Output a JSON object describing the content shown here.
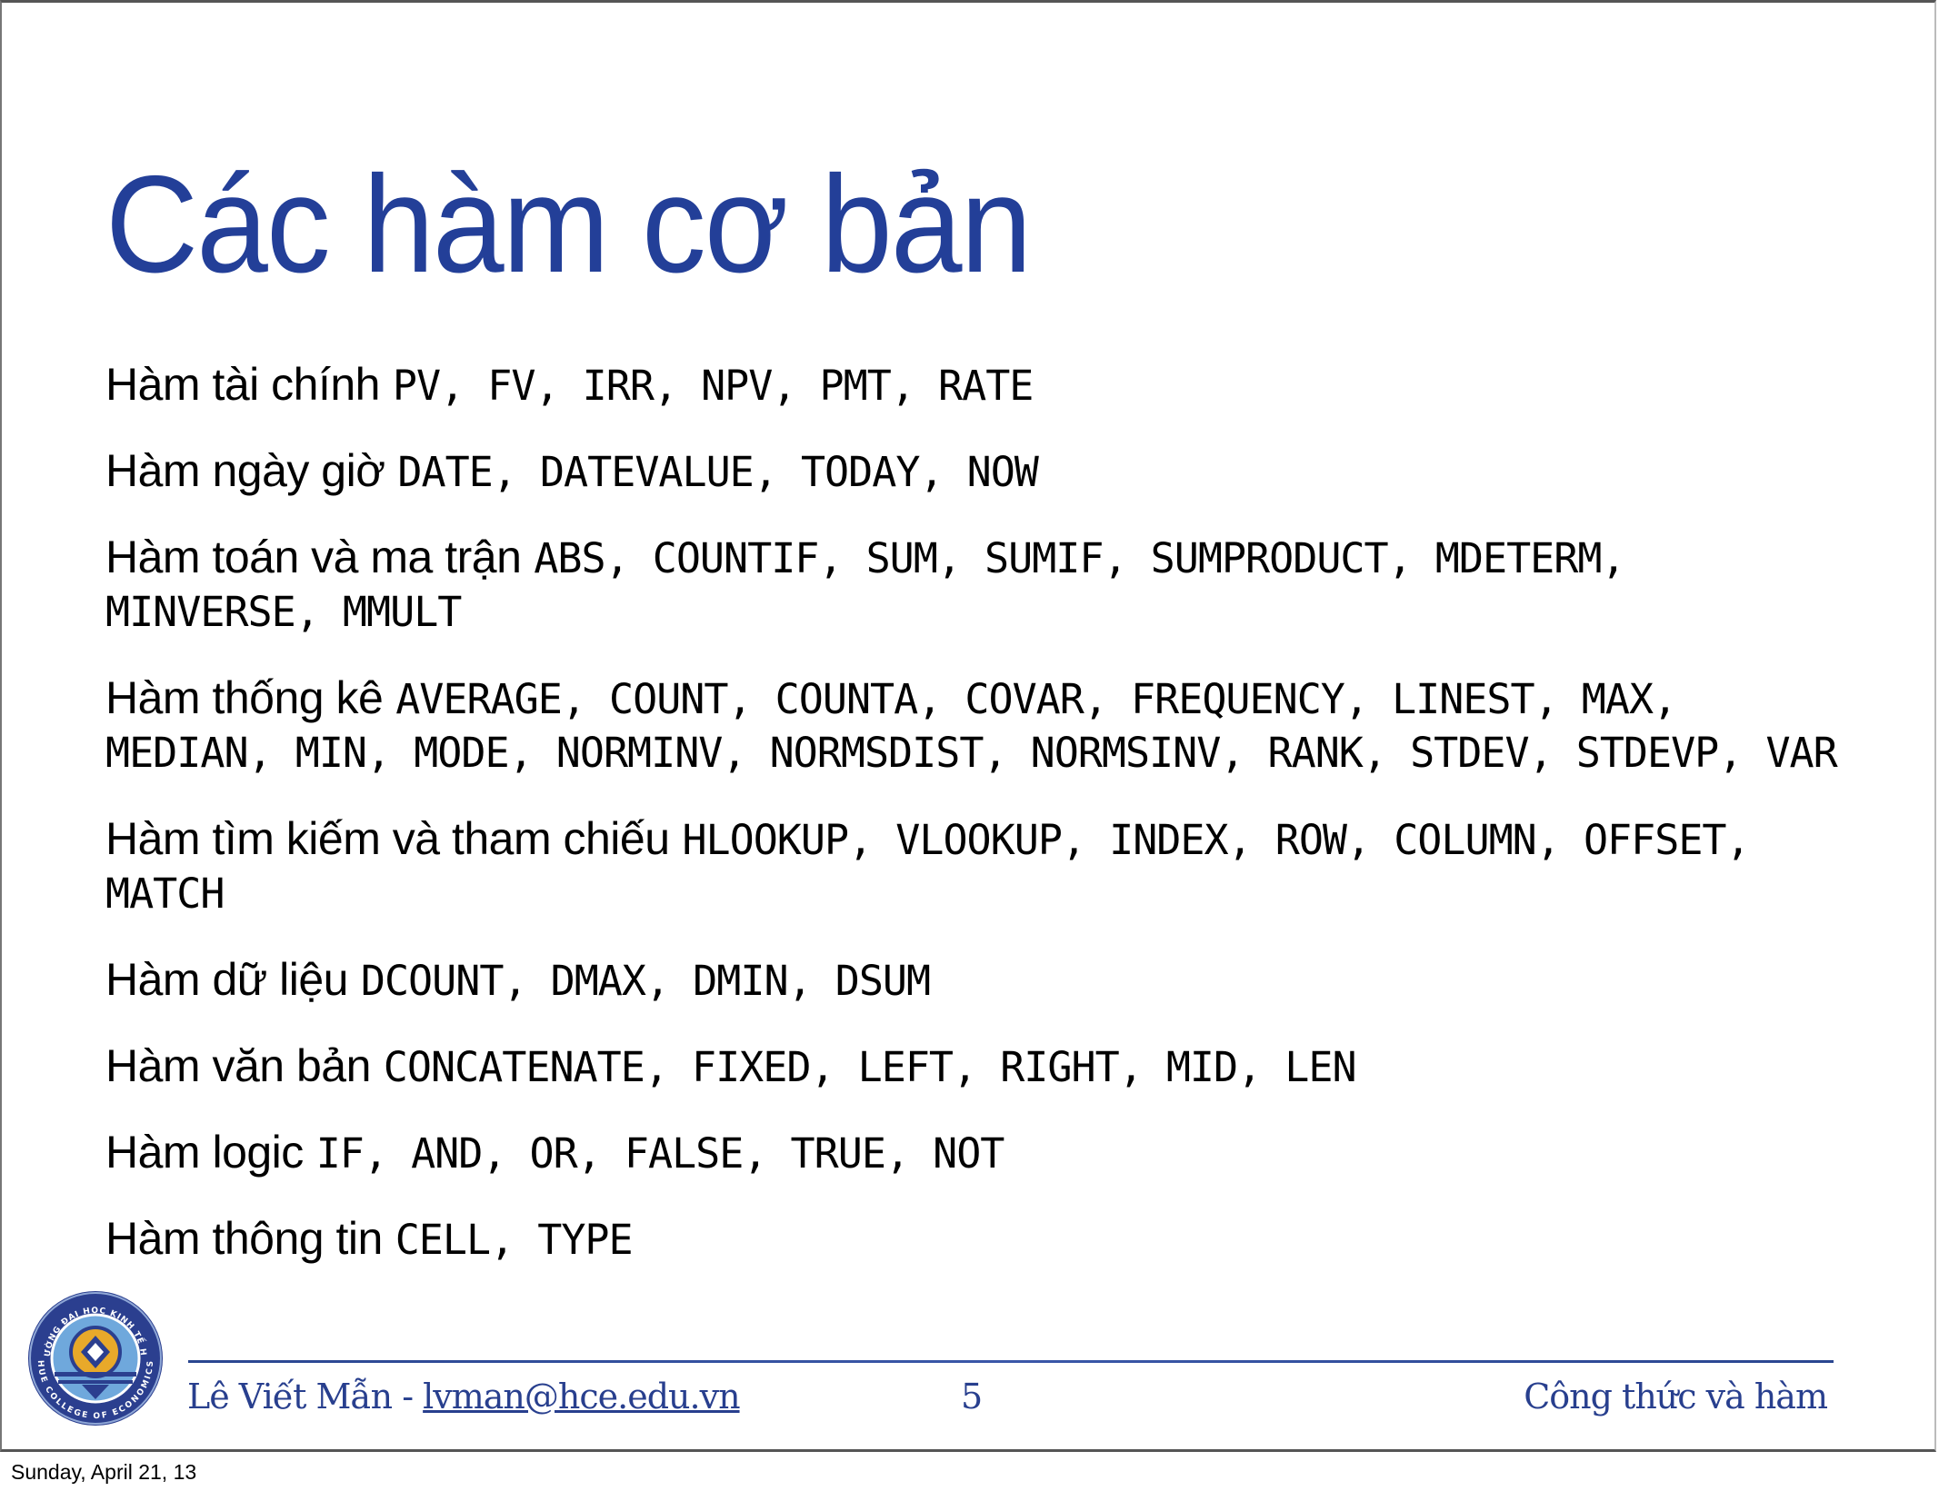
{
  "slide": {
    "title": "Các hàm cơ bản",
    "items": [
      {
        "label": "Hàm tài chính",
        "functions": "PV, FV, IRR, NPV, PMT, RATE"
      },
      {
        "label": "Hàm ngày giờ",
        "functions": "DATE, DATEVALUE, TODAY, NOW"
      },
      {
        "label": "Hàm toán và ma trận",
        "functions": "ABS, COUNTIF, SUM, SUMIF, SUMPRODUCT, MDETERM, MINVERSE, MMULT"
      },
      {
        "label": "Hàm thống kê",
        "functions": "AVERAGE, COUNT, COUNTA, COVAR, FREQUENCY, LINEST, MAX, MEDIAN, MIN, MODE, NORMINV, NORMSDIST, NORMSINV, RANK, STDEV, STDEVP, VAR"
      },
      {
        "label": "Hàm tìm kiếm và tham chiếu",
        "functions": "HLOOKUP, VLOOKUP, INDEX, ROW, COLUMN, OFFSET, MATCH"
      },
      {
        "label": "Hàm dữ liệu",
        "functions": "DCOUNT, DMAX, DMIN, DSUM"
      },
      {
        "label": "Hàm văn bản",
        "functions": "CONCATENATE, FIXED, LEFT, RIGHT, MID, LEN"
      },
      {
        "label": "Hàm logic",
        "functions": "IF, AND, OR, FALSE, TRUE, NOT"
      },
      {
        "label": "Hàm thông tin",
        "functions": "CELL, TYPE"
      }
    ]
  },
  "footer": {
    "author": "Lê Viết Mẫn - ",
    "email": "lvman@hce.edu.vn",
    "page_number": "5",
    "topic": "Công thức và hàm",
    "logo_text_top": "TRƯỜNG ĐẠI HỌC KINH TẾ HUẾ",
    "logo_text_bottom": "HUE COLLEGE OF ECONOMICS"
  },
  "print_date": "Sunday, April 21, 13",
  "colors": {
    "title": "#233f98",
    "footer_text": "#283f8e",
    "logo_ring": "#2b3f8f",
    "logo_inner": "#6fa8dc",
    "logo_gold": "#e8a92a"
  }
}
